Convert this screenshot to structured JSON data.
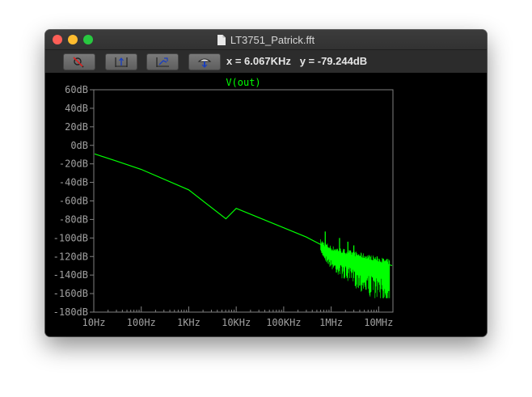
{
  "window": {
    "title": "LT3751_Patrick.fft"
  },
  "toolbar": {
    "buttons": [
      {
        "name": "zoom-cancel-icon"
      },
      {
        "name": "autorange-y-icon"
      },
      {
        "name": "pan-icon"
      },
      {
        "name": "pick-trace-icon"
      }
    ],
    "cursor_x": "x = 6.067KHz",
    "cursor_y": "y = -79.244dB"
  },
  "colors": {
    "trace": "#00ff00",
    "axis": "#808080",
    "labels": "#a0a0a0",
    "background": "#000000"
  },
  "chart_data": {
    "type": "line",
    "title": "V(out)",
    "xscale": "log",
    "xlim": [
      10,
      20000000
    ],
    "ylim": [
      -180,
      60
    ],
    "xticklabels": [
      "10Hz",
      "100Hz",
      "1KHz",
      "10KHz",
      "100KHz",
      "1MHz",
      "10MHz"
    ],
    "xtickvalues": [
      10,
      100,
      1000,
      10000,
      100000,
      1000000,
      10000000
    ],
    "yticklabels": [
      "60dB",
      "40dB",
      "20dB",
      "0dB",
      "-20dB",
      "-40dB",
      "-60dB",
      "-80dB",
      "-100dB",
      "-120dB",
      "-140dB",
      "-160dB",
      "-180dB"
    ],
    "ytickvalues": [
      60,
      40,
      20,
      0,
      -20,
      -40,
      -60,
      -80,
      -100,
      -120,
      -140,
      -160,
      -180
    ],
    "series": [
      {
        "name": "V(out)",
        "x": [
          8,
          10,
          30,
          100,
          1000,
          6067,
          10000,
          100000,
          300000,
          600000,
          1000000,
          3000000,
          10000000,
          20000000
        ],
        "y": [
          -7,
          -9,
          -17,
          -26,
          -48,
          -79.244,
          -68,
          -89,
          -99,
          -107,
          -114,
          -120,
          -126,
          -130
        ]
      }
    ],
    "noise_region": {
      "x_start": 600000,
      "x_end": 17000000,
      "y_min": -165,
      "y_max": -98,
      "harmonics": [
        {
          "x": 750000,
          "y": -93
        },
        {
          "x": 1500000,
          "y": -100
        },
        {
          "x": 2250000,
          "y": -104
        },
        {
          "x": 3000000,
          "y": -108
        }
      ]
    }
  }
}
